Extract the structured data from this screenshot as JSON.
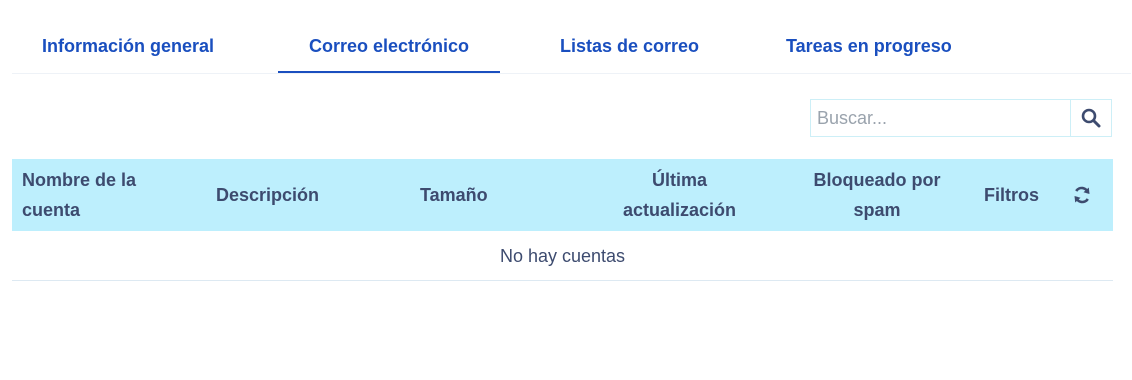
{
  "tabs": [
    {
      "label": "Información general",
      "active": false
    },
    {
      "label": "Correo electrónico",
      "active": true
    },
    {
      "label": "Listas de correo",
      "active": false
    },
    {
      "label": "Tareas en progreso",
      "active": false
    }
  ],
  "search": {
    "placeholder": "Buscar...",
    "value": "",
    "icon": "search-icon"
  },
  "table": {
    "columns": {
      "name": "Nombre de la cuenta",
      "description": "Descripción",
      "size": "Tamaño",
      "updated": "Última actualización",
      "spam": "Bloqueado por spam",
      "filters": "Filtros"
    },
    "refresh_icon": "refresh-icon",
    "empty_message": "No hay cuentas"
  },
  "colors": {
    "accent": "#1a4fbf",
    "header_bg": "#bdeffd",
    "header_text": "#3d4b6f"
  }
}
